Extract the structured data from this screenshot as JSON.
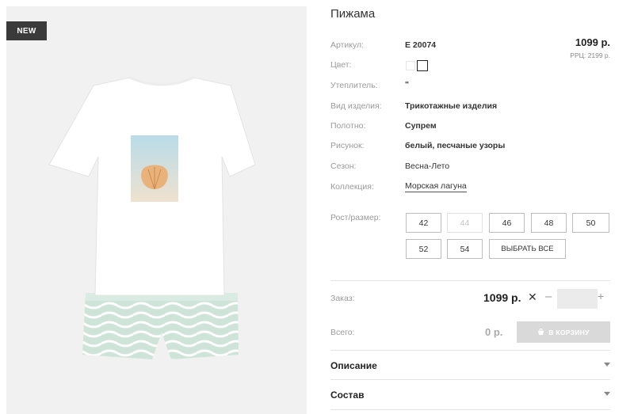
{
  "product": {
    "badge": "NEW",
    "title": "Пижама",
    "price": "1099 р.",
    "rrp": "РРЦ: 2199 р."
  },
  "properties": [
    {
      "label": "Артикул:",
      "value": "Е 20074"
    },
    {
      "label": "Цвет:",
      "value": ""
    },
    {
      "label": "Утеплитель:",
      "value": "\""
    },
    {
      "label": "Вид изделия:",
      "value": "Трикотажные изделия"
    },
    {
      "label": "Полотно:",
      "value": "Супрем"
    },
    {
      "label": "Рисунок:",
      "value": "белый, песчаные узоры"
    },
    {
      "label": "Сезон:",
      "value": "Весна-Лето"
    },
    {
      "label": "Коллекция:",
      "value": "Морская лагуна"
    }
  ],
  "colors": [
    "#ffffff",
    "#ffffff"
  ],
  "sizes": {
    "label": "Рост/размер:",
    "options": [
      "42",
      "44",
      "46",
      "48",
      "50",
      "52",
      "54"
    ],
    "disabled": [
      "44"
    ],
    "select_all": "ВЫБРАТЬ ВСЕ"
  },
  "order": {
    "label": "Заказ:",
    "price": "1099 р.",
    "times": "✕",
    "minus": "–",
    "plus": "+",
    "quantity": ""
  },
  "total": {
    "label": "Всего:",
    "value": "0 р.",
    "cart_button": "В КОРЗИНУ"
  },
  "accordions": [
    "Описание",
    "Состав"
  ]
}
